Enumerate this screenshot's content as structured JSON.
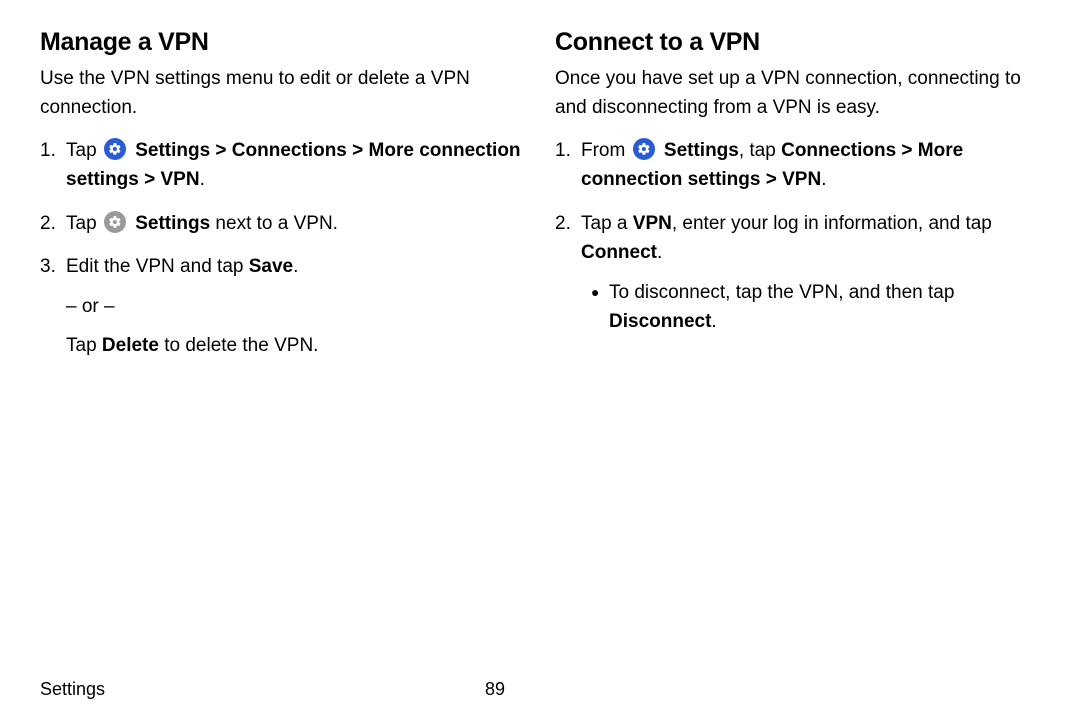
{
  "left": {
    "heading": "Manage a VPN",
    "intro": "Use the VPN settings menu to edit or delete a VPN connection.",
    "step1_pre": "Tap ",
    "step1_path": " Settings > Connections > More connection settings > VPN",
    "step1_post": ".",
    "step2_pre": "Tap ",
    "step2_bold": " Settings",
    "step2_post": " next to a VPN.",
    "step3_a": "Edit the VPN and tap ",
    "step3_a_bold": "Save",
    "step3_a_post": ".",
    "or": "– or –",
    "step3_b_pre": "Tap ",
    "step3_b_bold": "Delete",
    "step3_b_post": " to delete the VPN."
  },
  "right": {
    "heading": "Connect to a VPN",
    "intro": "Once you have set up a VPN connection, connecting to and disconnecting from a VPN is easy.",
    "step1_pre": "From ",
    "step1_mid1": " Settings",
    "step1_mid2": ", tap ",
    "step1_bold2": "Connections > More connection settings > VPN",
    "step1_post": ".",
    "step2_a": "Tap a ",
    "step2_bold": "VPN",
    "step2_b": ", enter your log in information, and tap ",
    "step2_bold2": "Connect",
    "step2_c": ".",
    "sub_a": "To disconnect, tap the VPN, and then tap ",
    "sub_bold": "Disconnect",
    "sub_b": "."
  },
  "footer": {
    "section": "Settings",
    "page": "89"
  },
  "nums": {
    "n1": "1.",
    "n2": "2.",
    "n3": "3."
  }
}
